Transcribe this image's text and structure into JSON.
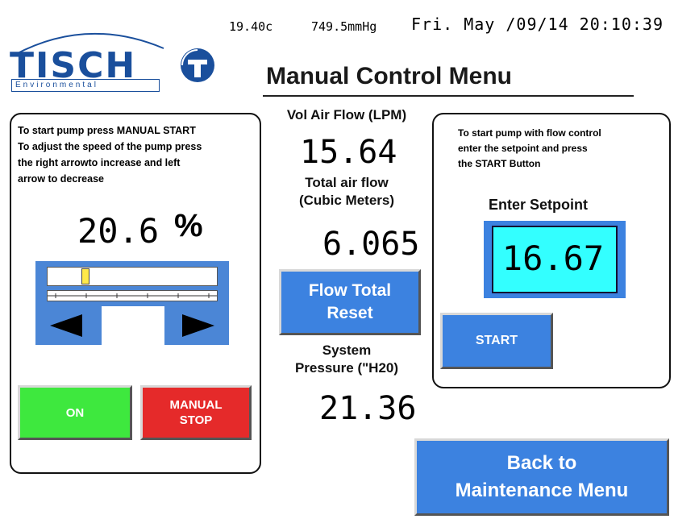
{
  "status": {
    "temperature": "19.40c",
    "pressure": "749.5mmHg",
    "datetime": "Fri. May /09/14 20:10:39"
  },
  "logo": {
    "word": "TISCH",
    "subtitle": "Environmental"
  },
  "title": "Manual Control Menu",
  "left_panel": {
    "instructions": [
      "To start pump press MANUAL START",
      "To adjust the speed of the pump press",
      "the right arrowto increase and left",
      "arrow to decrease"
    ],
    "speed_value": "20.6",
    "speed_unit": "%",
    "speed_level": 0.206,
    "on_label": "ON",
    "stop_label_1": "MANUAL",
    "stop_label_2": "STOP"
  },
  "center": {
    "vol_label": "Vol Air Flow (LPM)",
    "vol_value": "15.64",
    "total_label_1": "Total air flow",
    "total_label_2": "(Cubic Meters)",
    "total_value": "6.065",
    "reset_label_1": "Flow Total",
    "reset_label_2": "Reset",
    "sys_label_1": "System",
    "sys_label_2": "Pressure (\"H20)",
    "sys_value": "21.36"
  },
  "right_panel": {
    "instructions": [
      "To start pump with flow control",
      "enter the setpoint and press",
      "the START Button"
    ],
    "setpoint_label": "Enter Setpoint",
    "setpoint_value": "16.67",
    "start_label": "START"
  },
  "back_button": {
    "line1": "Back to",
    "line2": "Maintenance Menu"
  },
  "colors": {
    "brand_blue": "#1a4f9c",
    "button_blue": "#3c82e0",
    "on_green": "#3ee83e",
    "stop_red": "#e52a2a",
    "setpoint_cyan": "#33ffff",
    "slider_thumb": "#ffe94a"
  }
}
